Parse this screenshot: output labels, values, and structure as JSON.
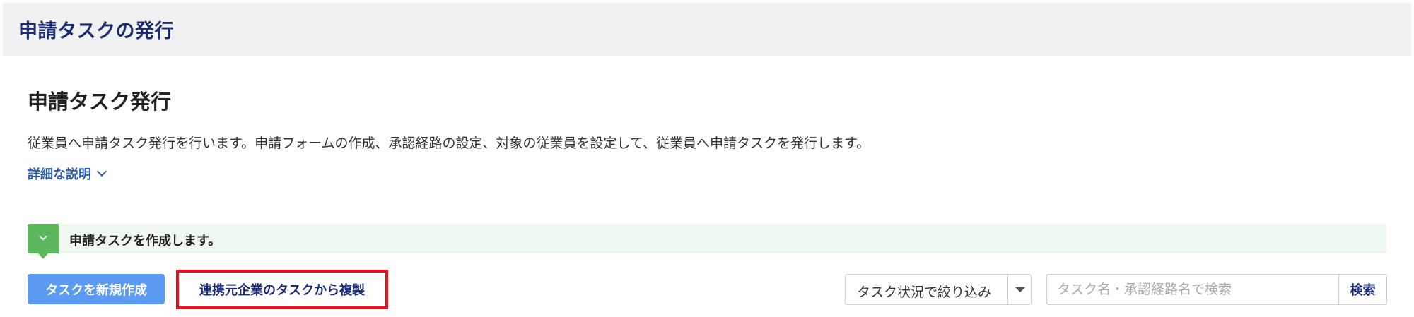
{
  "header": {
    "title": "申請タスクの発行"
  },
  "page": {
    "title": "申請タスク発行",
    "description": "従業員へ申請タスク発行を行います。申請フォームの作成、承認経路の設定、対象の従業員を設定して、従業員へ申請タスクを発行します。",
    "detail_link": "詳細な説明"
  },
  "notice": {
    "text": "申請タスクを作成します。",
    "icon": "chevron-down-icon"
  },
  "actions": {
    "new_task_label": "タスクを新規作成",
    "copy_task_label": "連携元企業のタスクから複製"
  },
  "filter": {
    "selected": "タスク状況で絞り込み"
  },
  "search": {
    "placeholder": "タスク名・承認経路名で検索",
    "value": "",
    "button_label": "検索"
  },
  "colors": {
    "header_bg": "#f1f1f1",
    "title_navy": "#1a2a73",
    "link_blue": "#2f5fa8",
    "notice_bg": "#eef8ee",
    "notice_green": "#5cb85c",
    "primary_button": "#5b9cf2",
    "highlight_red": "#e8131d"
  }
}
